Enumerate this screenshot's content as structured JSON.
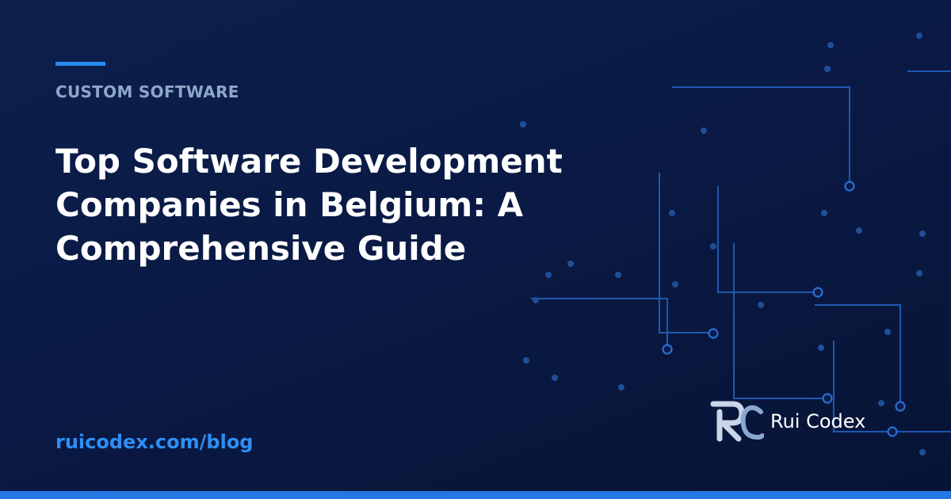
{
  "category": "CUSTOM SOFTWARE",
  "title": "Top Software Development Companies in Belgium: A Comprehensive Guide",
  "url": "ruicodex.com/blog",
  "brand": {
    "name": "Rui Codex",
    "logo_icon": "rc-monogram-icon"
  },
  "colors": {
    "background": "#0b1c48",
    "accent": "#2a8cf0",
    "category_text": "#8ea6c8",
    "url_text": "#2f8ff3",
    "circuit": "#1e58b0"
  },
  "decoration": "circuit-pattern"
}
